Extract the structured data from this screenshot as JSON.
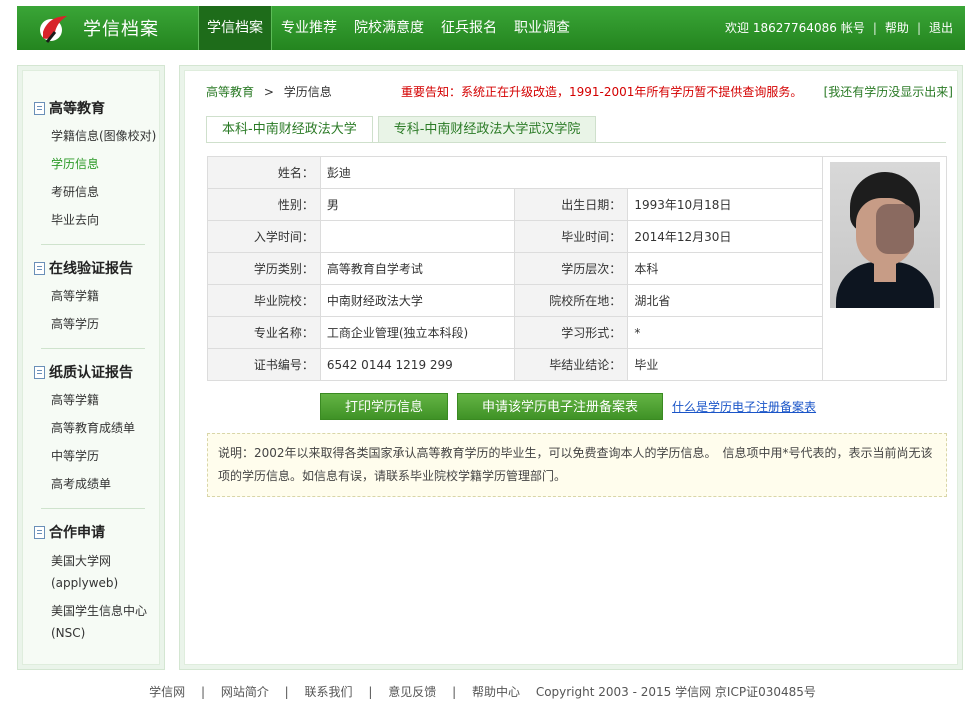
{
  "header": {
    "site_title": "学信档案",
    "nav": [
      "学信档案",
      "专业推荐",
      "院校满意度",
      "征兵报名",
      "职业调查"
    ],
    "welcome": "欢迎 18627764086",
    "account": "帐号",
    "help": "帮助",
    "logout": "退出"
  },
  "sidebar": {
    "sections": [
      {
        "title": "高等教育",
        "items": [
          "学籍信息(图像校对)",
          "学历信息",
          "考研信息",
          "毕业去向"
        ]
      },
      {
        "title": "在线验证报告",
        "items": [
          "高等学籍",
          "高等学历"
        ]
      },
      {
        "title": "纸质认证报告",
        "items": [
          "高等学籍",
          "高等教育成绩单",
          "中等学历",
          "高考成绩单"
        ]
      },
      {
        "title": "合作申请",
        "items": [
          "美国大学网\n(applyweb)",
          "美国学生信息中心\n(NSC)"
        ]
      }
    ]
  },
  "main": {
    "breadcrumb": {
      "root": "高等教育",
      "sep": ">",
      "current": "学历信息"
    },
    "notice": "重要告知：系统正在升级改造，1991-2001年所有学历暂不提供查询服务。",
    "missing_link": "[我还有学历没显示出来]",
    "tabs": [
      "本科-中南财经政法大学",
      "专科-中南财经政法大学武汉学院"
    ],
    "record": {
      "name_label": "姓名：",
      "name": "彭迪",
      "gender_label": "性别：",
      "gender": "男",
      "birth_label": "出生日期：",
      "birth": "1993年10月18日",
      "enroll_label": "入学时间：",
      "enroll": "",
      "grad_label": "毕业时间：",
      "grad": "2014年12月30日",
      "type_label": "学历类别：",
      "type": "高等教育自学考试",
      "level_label": "学历层次：",
      "level": "本科",
      "school_label": "毕业院校：",
      "school": "中南财经政法大学",
      "location_label": "院校所在地：",
      "location": "湖北省",
      "major_label": "专业名称：",
      "major": "工商企业管理(独立本科段)",
      "mode_label": "学习形式：",
      "mode": "*",
      "cert_label": "证书编号：",
      "cert": "6542 0144 1219 299",
      "result_label": "毕结业结论：",
      "result": "毕业"
    },
    "buttons": {
      "print": "打印学历信息",
      "apply": "申请该学历电子注册备案表",
      "what_is": "什么是学历电子注册备案表"
    },
    "note": "说明：2002年以来取得各类国家承认高等教育学历的毕业生，可以免费查询本人的学历信息。　信息项中用*号代表的，表示当前尚无该项的学历信息。如信息有误，请联系毕业院校学籍学历管理部门。"
  },
  "footer": {
    "links": [
      "学信网",
      "网站简介",
      "联系我们",
      "意见反馈",
      "帮助中心"
    ],
    "copyright": "Copyright 2003 - 2015  学信网  京ICP证030485号"
  },
  "colors": {
    "brand_green": "#2a9a26",
    "notice_red": "#d40000",
    "link_blue": "#1a55c8"
  }
}
